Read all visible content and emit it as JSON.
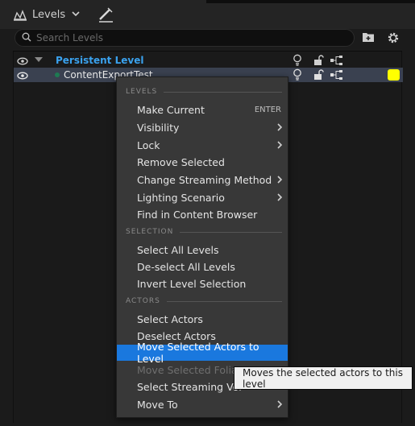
{
  "toolbar": {
    "tab_label": "Levels",
    "tab_icon": "levels-icon",
    "edit_icon": "edit-pencil-icon"
  },
  "search": {
    "placeholder": "Search Levels",
    "value": ""
  },
  "levels": {
    "persistent_label": "Persistent Level",
    "content_label": "ContentExportTest",
    "content_color": "#ffff00"
  },
  "menu": {
    "sections": {
      "levels": "LEVELS",
      "selection": "SELECTION",
      "actors": "ACTORS"
    },
    "items": [
      {
        "label": "Make Current",
        "shortcut": "ENTER"
      },
      {
        "label": "Visibility"
      },
      {
        "label": "Lock"
      },
      {
        "label": "Remove Selected"
      },
      {
        "label": "Change Streaming Method"
      },
      {
        "label": "Lighting Scenario"
      },
      {
        "label": "Find in Content Browser"
      },
      {
        "label": "Select All Levels"
      },
      {
        "label": "De-select All Levels"
      },
      {
        "label": "Invert Level Selection"
      },
      {
        "label": "Select Actors"
      },
      {
        "label": "Deselect Actors"
      },
      {
        "label": "Move Selected Actors to Level"
      },
      {
        "label": "Move Selected Foliag"
      },
      {
        "label": "Select Streaming Vol"
      },
      {
        "label": "Move To"
      }
    ]
  },
  "tooltip": {
    "text": "Moves the selected actors to this level"
  },
  "colors": {
    "accent": "#1a78de",
    "persistent_text": "#3aa2ef",
    "selected_row": "#3a4150"
  }
}
